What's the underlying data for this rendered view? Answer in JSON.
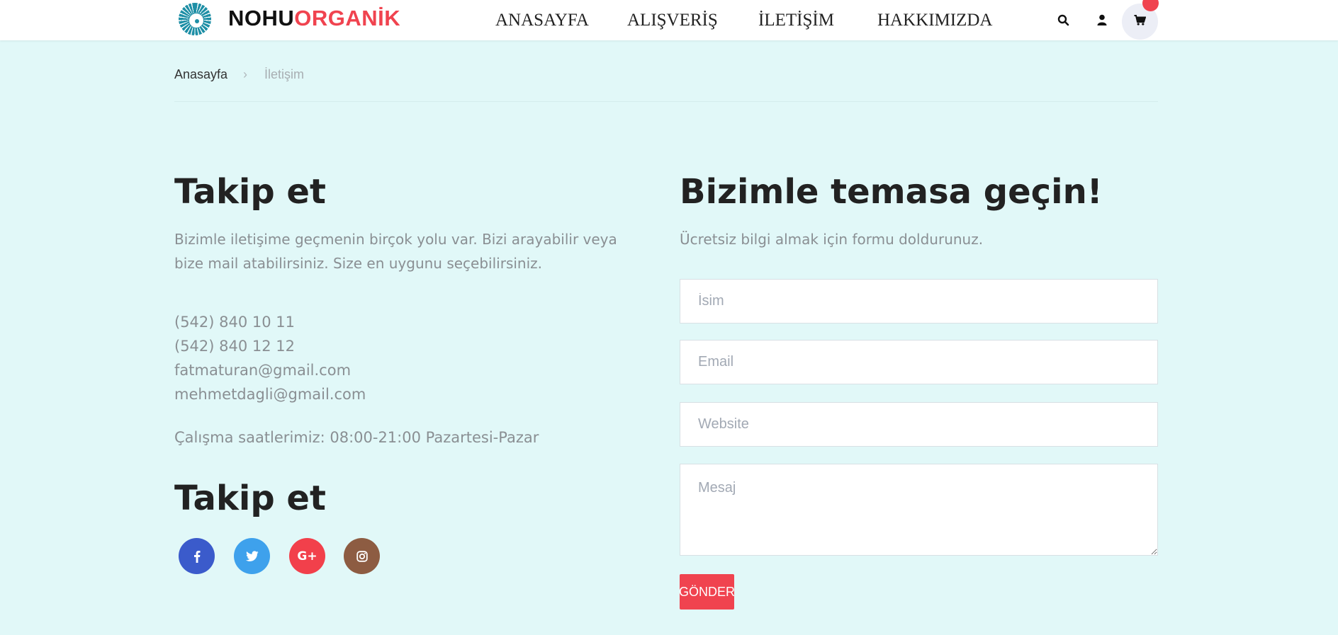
{
  "header": {
    "brand_part1": "NOHU",
    "brand_part2": "ORGANİK",
    "nav": [
      "ANASAYFA",
      "ALIŞVERİŞ",
      "İLETİŞİM",
      "HAKKIMIZDA"
    ],
    "icons": [
      "search-icon",
      "user-icon",
      "cart-icon"
    ]
  },
  "breadcrumb": {
    "home": "Anasayfa",
    "separator": "›",
    "current": "İletişim"
  },
  "left": {
    "title": "Takip et",
    "description": "Bizimle iletişime geçmenin birçok yolu var. Bizi arayabilir veya bize mail atabilirsiniz. Size en uygunu seçebilirsiniz.",
    "phones": [
      "(542) 840 10 11",
      "(542) 840 12 12"
    ],
    "emails": [
      "fatmaturan@gmail.com",
      "mehmetdagli@gmail.com"
    ],
    "hours": "Çalışma saatlerimiz: 08:00-21:00 Pazartesi-Pazar",
    "follow_title": "Takip et",
    "social": [
      {
        "icon": "facebook-icon",
        "glyph": "f",
        "color": "#3b5bcb"
      },
      {
        "icon": "twitter-icon",
        "glyph": "🐦",
        "color": "#3ea1ec"
      },
      {
        "icon": "google-plus-icon",
        "glyph": "G+",
        "color": "#f2404b"
      },
      {
        "icon": "instagram-icon",
        "glyph": "◎",
        "color": "#8d5c42"
      }
    ]
  },
  "form": {
    "title": "Bizimle temasa geçin!",
    "subtitle": "Ücretsiz bilgi almak için formu doldurunuz.",
    "name_placeholder": "İsim",
    "email_placeholder": "Email",
    "website_placeholder": "Website",
    "message_placeholder": "Mesaj",
    "submit_label": "GÖNDER"
  },
  "colors": {
    "background": "#e1f8f8",
    "accent": "#f0434f",
    "text_muted": "#8a8f93"
  }
}
